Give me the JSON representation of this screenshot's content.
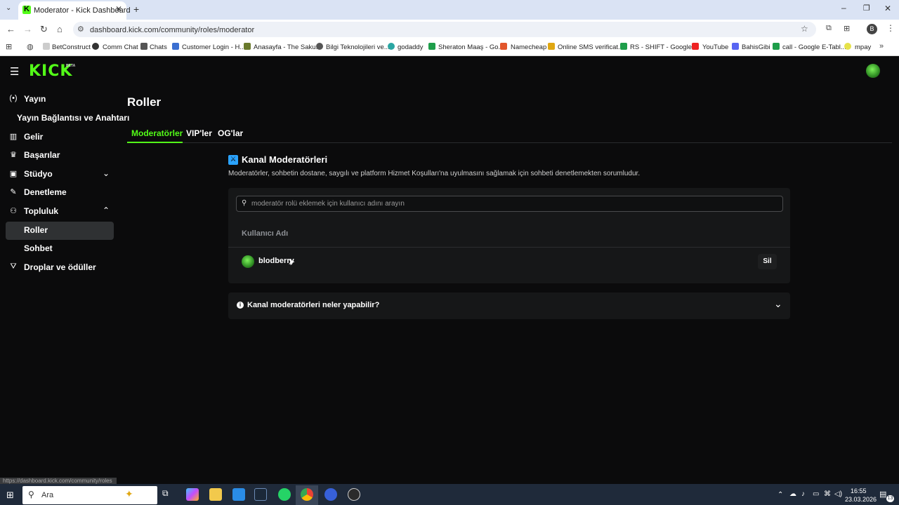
{
  "browser": {
    "tab_title": "Moderator - Kick Dashboard",
    "new_tab": "+",
    "url": "dashboard.kick.com/community/roles/moderator",
    "profile_initial": "B",
    "bookmarks": [
      "BetConstruct",
      "Comm Chat",
      "Chats",
      "Customer Login - H...",
      "Anasayfa - The Saku...",
      "Bilgi Teknolojileri ve...",
      "godaddy",
      "Sheraton Maaş - Go...",
      "Namecheap",
      "Online SMS verificat...",
      "RS - SHIFT - Google...",
      "YouTube",
      "BahisGibi",
      "call - Google E-Tabl...",
      "mpay"
    ],
    "status_url": "https://dashboard.kick.com/community/roles"
  },
  "header": {
    "logo": "KICK",
    "beta": "BETA"
  },
  "sidebar": {
    "items": [
      {
        "label": "Yayın",
        "icon": "broadcast-icon"
      },
      {
        "label": "Yayın Bağlantısı ve Anahtarı"
      },
      {
        "label": "Gelir",
        "icon": "chart-icon"
      },
      {
        "label": "Başarılar",
        "icon": "trophy-icon"
      },
      {
        "label": "Stüdyo",
        "icon": "studio-icon"
      },
      {
        "label": "Denetleme",
        "icon": "wrench-icon"
      },
      {
        "label": "Topluluk",
        "icon": "community-icon"
      },
      {
        "label": "Roller"
      },
      {
        "label": "Sohbet"
      },
      {
        "label": "Droplar ve ödüller",
        "icon": "gift-icon"
      }
    ]
  },
  "main": {
    "title": "Roller",
    "tabs": [
      "Moderatörler",
      "VIP'ler",
      "OG'lar"
    ],
    "section_title": "Kanal Moderatörleri",
    "section_desc": "Moderatörler, sohbetin dostane, saygılı ve platform Hizmet Koşulları'na uyulmasını sağlamak için sohbeti denetlemekten sorumludur.",
    "search_placeholder": "moderatör rolü eklemek için kullanıcı adını arayın",
    "column_username": "Kullanıcı Adı",
    "moderators": [
      {
        "username": "blodberry",
        "remove": "Sil"
      }
    ],
    "faq_title": "Kanal moderatörleri neler yapabilir?"
  },
  "taskbar": {
    "search": "Ara",
    "time": "16:55",
    "date": "23.03.2026",
    "notifications": "13"
  },
  "colors": {
    "accent": "#53fc18",
    "bg": "#0b0b0c",
    "card": "#161718"
  }
}
